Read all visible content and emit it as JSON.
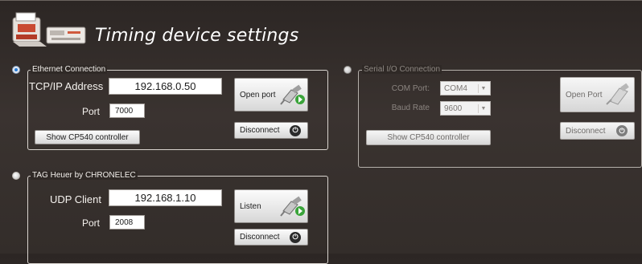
{
  "header": {
    "title": "Timing device settings",
    "logo_icon": "timing-printer-device-icon"
  },
  "ethernet": {
    "legend": "Ethernet Connection",
    "selected": true,
    "tcp_label": "TCP/IP Address",
    "tcp_value": "192.168.0.50",
    "port_label": "Port",
    "port_value": "7000",
    "open_port_label": "Open port",
    "disconnect_label": "Disconnect",
    "show_controller_label": "Show CP540 controller"
  },
  "serial": {
    "legend": "Serial I/O Connection",
    "selected": false,
    "com_label": "COM Port:",
    "com_value": "COM4",
    "baud_label": "Baud Rate",
    "baud_value": "9600",
    "open_port_label": "Open Port",
    "disconnect_label": "Disconnect",
    "show_controller_label": "Show CP540 controller"
  },
  "tag": {
    "legend": "TAG Heuer by CHRONELEC",
    "selected": false,
    "udp_label": "UDP Client",
    "udp_value": "192.168.1.10",
    "port_label": "Port",
    "port_value": "2008",
    "listen_label": "Listen",
    "disconnect_label": "Disconnect"
  },
  "colors": {
    "background": "#2f2926",
    "accent_radio": "#2f7fd6",
    "connect_ok": "#3aa43a"
  }
}
